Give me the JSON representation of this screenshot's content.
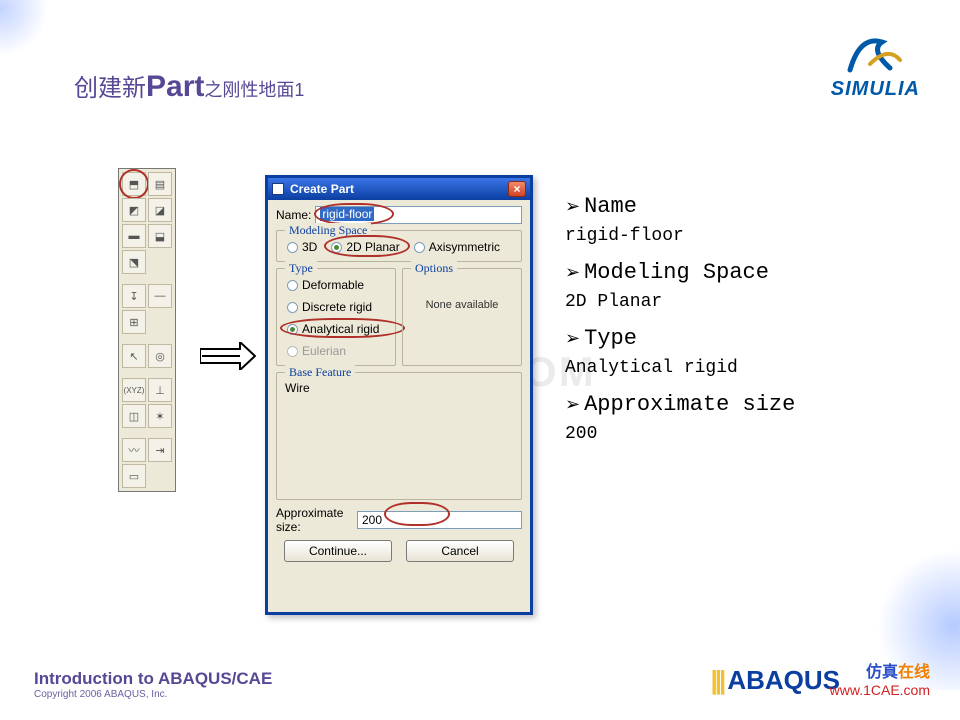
{
  "slide": {
    "title_pre": "创建新",
    "title_part": "Part",
    "title_post": "之刚性地面1"
  },
  "logo_simulia": "SIMULIA",
  "dialog": {
    "title": "Create Part",
    "name_label": "Name:",
    "name_value": "rigid-floor",
    "modeling_space_legend": "Modeling Space",
    "ms_3d": "3D",
    "ms_2d": "2D Planar",
    "ms_axi": "Axisymmetric",
    "type_legend": "Type",
    "type_deformable": "Deformable",
    "type_discrete": "Discrete rigid",
    "type_analytical": "Analytical rigid",
    "type_eulerian": "Eulerian",
    "options_legend": "Options",
    "options_text": "None available",
    "base_feature_legend": "Base Feature",
    "base_feature_value": "Wire",
    "approx_label": "Approximate size:",
    "approx_value": "200",
    "continue": "Continue...",
    "cancel": "Cancel"
  },
  "annot": {
    "h1": "Name",
    "v1": "rigid-floor",
    "h2": "Modeling Space",
    "v2": "2D Planar",
    "h3": "Type",
    "v3": "Analytical rigid",
    "h4": "Approximate size",
    "v4": "200"
  },
  "watermark": "1CAE.COM",
  "footer": {
    "line1": "Introduction to ABAQUS/CAE",
    "line2": "Copyright 2006 ABAQUS, Inc."
  },
  "abaqus_logo": "ABAQUS",
  "cn_overlay": {
    "line1a": "仿真",
    "line1b": "在线",
    "line2": "www.1CAE.com"
  },
  "icons": {
    "part": "⬒",
    "mgr": "▤",
    "shape1": "◩",
    "shape2": "◪",
    "solid": "▬",
    "shell": "⬓",
    "cut": "⬔",
    "wire": "—",
    "datum": "↧",
    "partition": "⊞",
    "xyz": "(XYZ)",
    "axis": "⊥",
    "plane": "◫",
    "csys": "✶",
    "plot": "〰",
    "amp": "⇥",
    "last": "▭"
  }
}
